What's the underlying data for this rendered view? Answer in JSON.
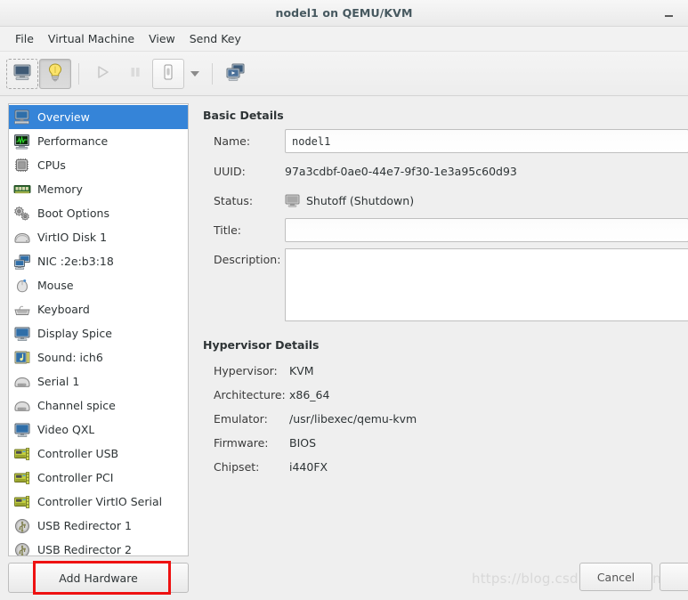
{
  "window": {
    "title": "nodel1 on QEMU/KVM",
    "minimize_label": "–"
  },
  "menubar": {
    "items": [
      {
        "label": "File",
        "name": "menu-file"
      },
      {
        "label": "Virtual Machine",
        "name": "menu-virtual-machine"
      },
      {
        "label": "View",
        "name": "menu-view"
      },
      {
        "label": "Send Key",
        "name": "menu-send-key"
      }
    ]
  },
  "toolbar": {
    "buttons": [
      {
        "icon": "console-monitor-icon",
        "state": "focused",
        "enabled": true
      },
      {
        "icon": "lightbulb-details-icon",
        "state": "pressed",
        "enabled": true
      },
      {
        "icon": "play-run-icon",
        "state": "disabled",
        "enabled": false
      },
      {
        "icon": "pause-icon",
        "state": "disabled",
        "enabled": false
      },
      {
        "icon": "power-shutdown-icon",
        "state": "boxed",
        "enabled": true
      },
      {
        "icon": "chevron-down-icon",
        "state": "arrow",
        "enabled": true
      },
      {
        "icon": "snapshot-screens-icon",
        "state": "normal",
        "enabled": true
      }
    ]
  },
  "sidebar": {
    "items": [
      {
        "label": "Overview",
        "icon": "overview-monitor-icon",
        "selected": true
      },
      {
        "label": "Performance",
        "icon": "performance-graph-icon",
        "selected": false
      },
      {
        "label": "CPUs",
        "icon": "cpu-chip-icon",
        "selected": false
      },
      {
        "label": "Memory",
        "icon": "memory-stick-icon",
        "selected": false
      },
      {
        "label": "Boot Options",
        "icon": "gears-icon",
        "selected": false
      },
      {
        "label": "VirtIO Disk 1",
        "icon": "hard-disk-icon",
        "selected": false
      },
      {
        "label": "NIC :2e:b3:18",
        "icon": "network-card-icon",
        "selected": false
      },
      {
        "label": "Mouse",
        "icon": "mouse-icon",
        "selected": false
      },
      {
        "label": "Keyboard",
        "icon": "keyboard-icon",
        "selected": false
      },
      {
        "label": "Display Spice",
        "icon": "display-monitor-icon",
        "selected": false
      },
      {
        "label": "Sound: ich6",
        "icon": "sound-card-icon",
        "selected": false
      },
      {
        "label": "Serial 1",
        "icon": "serial-port-icon",
        "selected": false
      },
      {
        "label": "Channel spice",
        "icon": "channel-icon",
        "selected": false
      },
      {
        "label": "Video QXL",
        "icon": "video-monitor-icon",
        "selected": false
      },
      {
        "label": "Controller USB",
        "icon": "controller-card-icon",
        "selected": false
      },
      {
        "label": "Controller PCI",
        "icon": "controller-card-icon",
        "selected": false
      },
      {
        "label": "Controller VirtIO Serial",
        "icon": "controller-card-icon",
        "selected": false
      },
      {
        "label": "USB Redirector 1",
        "icon": "usb-icon",
        "selected": false
      },
      {
        "label": "USB Redirector 2",
        "icon": "usb-icon",
        "selected": false
      }
    ],
    "add_hardware_label": "Add Hardware"
  },
  "basic_details": {
    "heading": "Basic Details",
    "name_label": "Name:",
    "name_value": "nodel1",
    "uuid_label": "UUID:",
    "uuid_value": "97a3cdbf-0ae0-44e7-9f30-1e3a95c60d93",
    "status_label": "Status:",
    "status_value": "Shutoff (Shutdown)",
    "status_icon": "shutoff-monitor-icon",
    "title_label": "Title:",
    "title_value": "",
    "description_label": "Description:",
    "description_value": ""
  },
  "hypervisor_details": {
    "heading": "Hypervisor Details",
    "rows": [
      {
        "label": "Hypervisor:",
        "value": "KVM"
      },
      {
        "label": "Architecture:",
        "value": "x86_64"
      },
      {
        "label": "Emulator:",
        "value": "/usr/libexec/qemu-kvm"
      },
      {
        "label": "Firmware:",
        "value": "BIOS"
      },
      {
        "label": "Chipset:",
        "value": "i440FX"
      }
    ]
  },
  "footer": {
    "cancel_label": "Cancel",
    "second_button_label": ""
  },
  "watermark": {
    "text": "https://blog.csdn.net/lgmeng"
  },
  "colors": {
    "selection": "#3584d8",
    "highlight_box": "#ee1111",
    "window_bg": "#efefef"
  }
}
